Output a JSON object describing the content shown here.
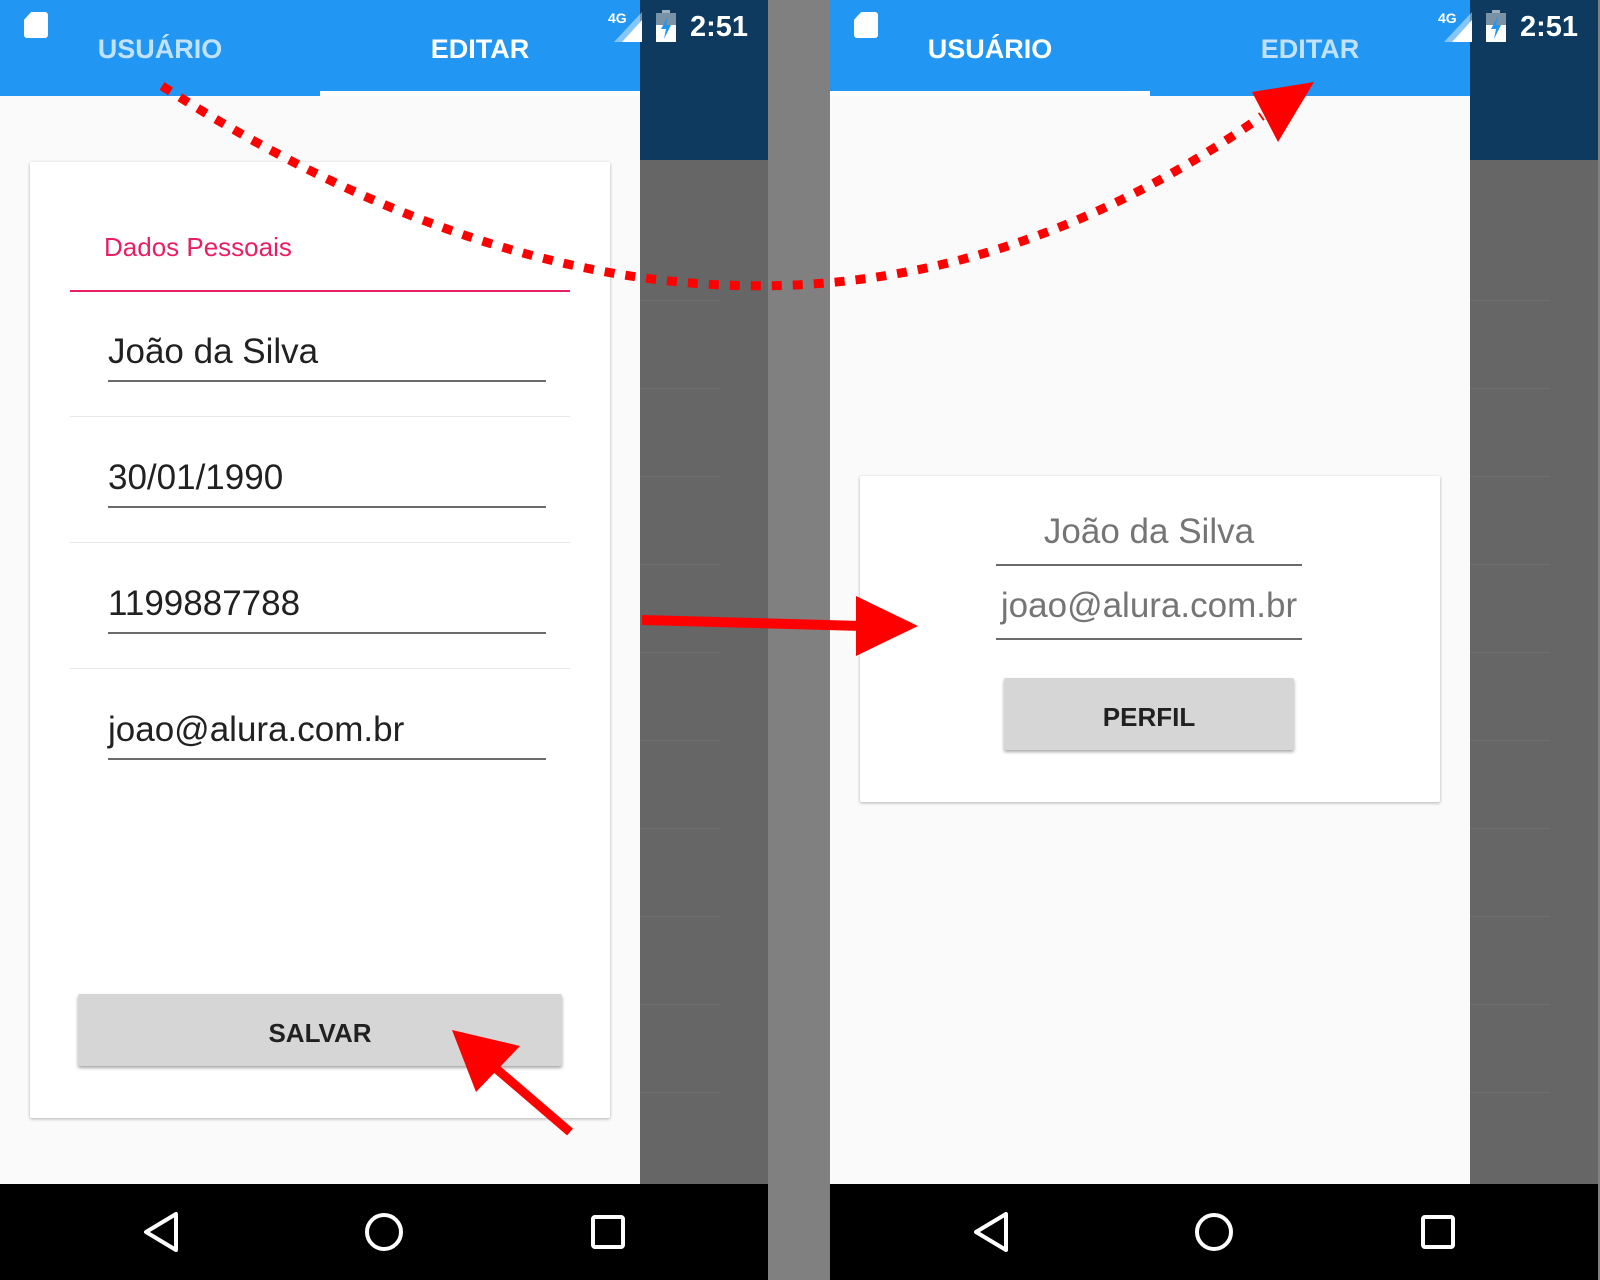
{
  "status_bar": {
    "network": "4G",
    "time": "2:51"
  },
  "tabs": {
    "user": "USUÁRIO",
    "edit": "EDITAR"
  },
  "edit_screen": {
    "section_title": "Dados Pessoais",
    "fields": {
      "name": "João da Silva",
      "birth_date": "30/01/1990",
      "phone": "1199887788",
      "email": "joao@alura.com.br"
    },
    "save_button": "SALVAR"
  },
  "profile_screen": {
    "name": "João da Silva",
    "email": "joao@alura.com.br",
    "profile_button": "PERFIL"
  },
  "colors": {
    "appbar": "#2196f3",
    "accent": "#e91e63",
    "arrow": "#ff0000",
    "navbar": "#000000"
  },
  "icons": {
    "sd_card": "sd-card-icon",
    "signal": "signal-icon",
    "battery": "battery-icon",
    "back": "back-triangle-icon",
    "home": "home-circle-icon",
    "recents": "recents-square-icon"
  }
}
